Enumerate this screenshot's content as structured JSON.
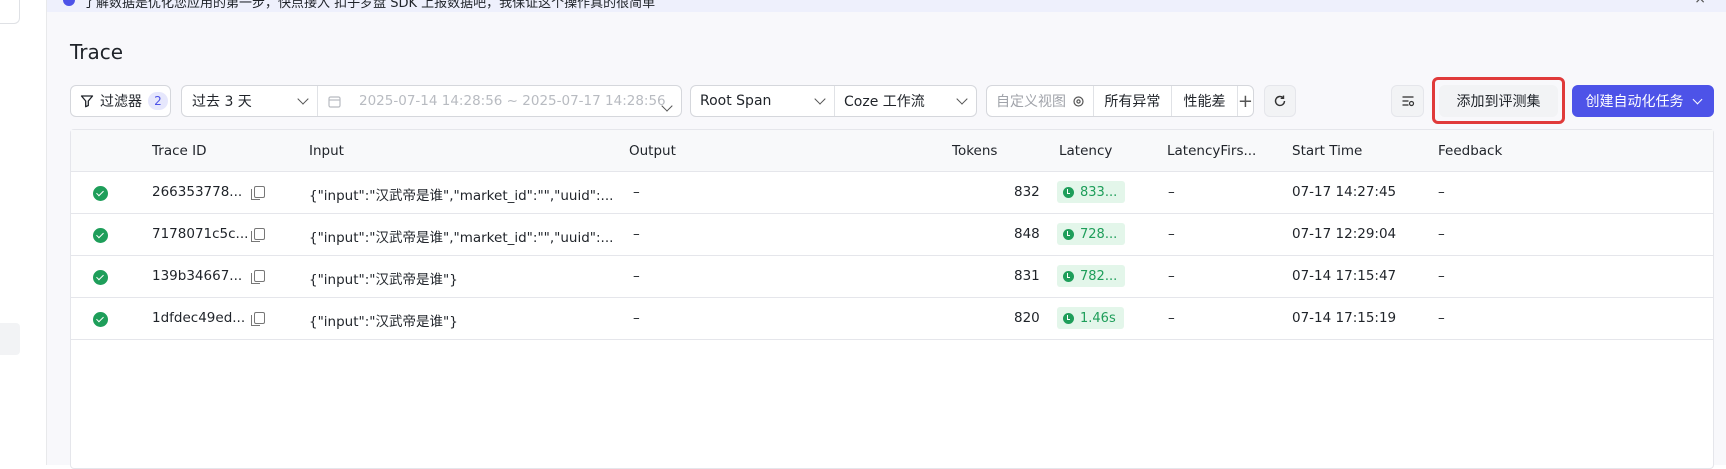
{
  "notice": {
    "text": "了解数据是优化您应用的第一步，快点接入 扣子罗盘 SDK 上报数据吧，我保证这个操作真的很简单",
    "close": "×"
  },
  "page_title": "Trace",
  "toolbar": {
    "filter_label": "过滤器",
    "filter_count": "2",
    "time_range": "过去 3 天",
    "date_range": "2025-07-14 14:28:56 ~ 2025-07-17 14:28:56",
    "span_type": "Root Span",
    "platform": "Coze 工作流",
    "custom_view": "自定义视图",
    "view_all_errors": "所有异常",
    "view_slow": "性能差",
    "add_view": "+",
    "add_to_eval": "添加到评测集",
    "create_task": "创建自动化任务"
  },
  "table": {
    "headers": [
      "Trace ID",
      "Input",
      "Output",
      "Tokens",
      "Latency",
      "LatencyFirs...",
      "Start Time",
      "Feedback"
    ],
    "rows": [
      {
        "trace_id": "266353778...",
        "input": "{\"input\":\"汉武帝是谁\",\"market_id\":\"\",\"uuid\":...",
        "output": "–",
        "tokens": "832",
        "latency": "833...",
        "latency_first": "–",
        "start_time": "07-17 14:27:45",
        "feedback": "–"
      },
      {
        "trace_id": "7178071c5c...",
        "input": "{\"input\":\"汉武帝是谁\",\"market_id\":\"\",\"uuid\":...",
        "output": "–",
        "tokens": "848",
        "latency": "728...",
        "latency_first": "–",
        "start_time": "07-17 12:29:04",
        "feedback": "–"
      },
      {
        "trace_id": "139b34667...",
        "input": "{\"input\":\"汉武帝是谁\"}",
        "output": "–",
        "tokens": "831",
        "latency": "782...",
        "latency_first": "–",
        "start_time": "07-14 17:15:47",
        "feedback": "–"
      },
      {
        "trace_id": "1dfdec49ed...",
        "input": "{\"input\":\"汉武帝是谁\"}",
        "output": "–",
        "tokens": "820",
        "latency": "1.46s",
        "latency_first": "–",
        "start_time": "07-14 17:15:19",
        "feedback": "–"
      }
    ]
  },
  "colors": {
    "accent": "#4d53e8",
    "success": "#1e9e5a",
    "highlight": "#e03a3a"
  },
  "icons": [
    "filter-icon",
    "calendar-icon",
    "gear-icon",
    "refresh-icon",
    "columns-icon",
    "copy-icon",
    "check-circle-icon",
    "clock-icon"
  ]
}
